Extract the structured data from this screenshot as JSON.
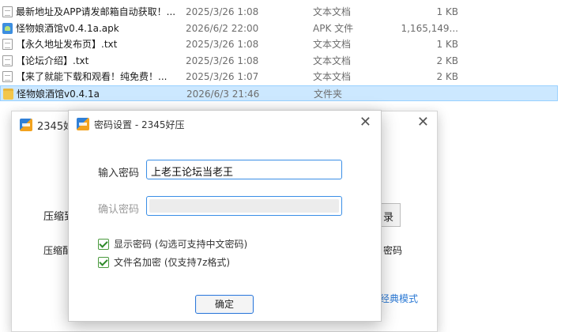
{
  "file_list": [
    {
      "icon": "document-icon",
      "name": "最新地址及APP请发邮箱自动获取！...",
      "date": "2025/3/26 1:08",
      "type": "文本文档",
      "size": "1 KB",
      "selected": false
    },
    {
      "icon": "apk-icon",
      "name": "怪物娘酒馆v0.4.1a.apk",
      "date": "2026/6/2 22:00",
      "type": "APK 文件",
      "size": "1,165,149...",
      "selected": false
    },
    {
      "icon": "document-icon",
      "name": "【永久地址发布页】.txt",
      "date": "2025/3/26 1:08",
      "type": "文本文档",
      "size": "1 KB",
      "selected": false
    },
    {
      "icon": "document-icon",
      "name": "【论坛介绍】.txt",
      "date": "2025/3/26 1:08",
      "type": "文本文档",
      "size": "2 KB",
      "selected": false
    },
    {
      "icon": "document-icon",
      "name": "【来了就能下载和观看！纯免费！...",
      "date": "2025/3/26 1:07",
      "type": "文本文档",
      "size": "2 KB",
      "selected": false
    },
    {
      "icon": "folder-icon",
      "name": "怪物娘酒馆v0.4.1a",
      "date": "2026/6/3 21:46",
      "type": "文件夹",
      "size": "",
      "selected": true
    }
  ],
  "back_window": {
    "title": "2345好",
    "label_1": "压缩到",
    "label_2": "压缩配",
    "button_partial": "录",
    "text_partial": "密码",
    "link_partial": "经典模式"
  },
  "dialog": {
    "title": "密码设置 - 2345好压",
    "password_label": "输入密码",
    "password_value": "上老王论坛当老王",
    "confirm_label": "确认密码",
    "confirm_value": "",
    "show_password_label": "显示密码 (勾选可支持中文密码)",
    "show_password_checked": true,
    "encrypt_filenames_label": "文件名加密 (仅支持7z格式)",
    "encrypt_filenames_checked": true,
    "ok_label": "确定"
  },
  "colors": {
    "selection_bg": "#cce8ff",
    "accent_border": "#3a8ee6",
    "checkbox_green": "#2f8a2a",
    "link_blue": "#2a78d4"
  }
}
